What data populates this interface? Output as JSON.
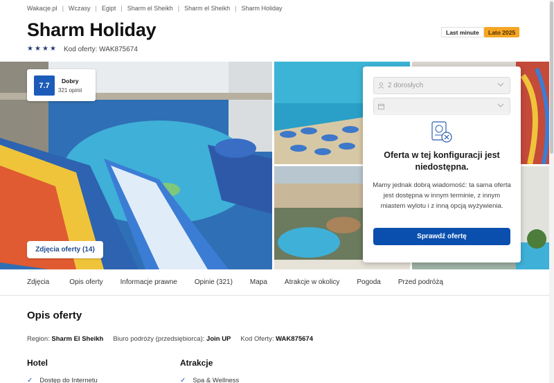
{
  "breadcrumb": [
    "Wakacje.pl",
    "Wczasy",
    "Egipt",
    "Sharm el Sheikh",
    "Sharm el Sheikh",
    "Sharm Holiday"
  ],
  "hotel": {
    "name": "Sharm Holiday",
    "stars": 4,
    "offer_code_label": "Kod oferty: WAK875674"
  },
  "badges": {
    "last_minute": "Last minute",
    "season": "Lato 2025"
  },
  "rating": {
    "score": "7.7",
    "word": "Dobry",
    "count": "321 opinii"
  },
  "photos_button": "Zdjęcia oferty (14)",
  "booking": {
    "guests_value": "2 dorosłych",
    "unavailable_title": "Oferta w tej konfiguracji jest niedostępna.",
    "unavailable_text": "Mamy jednak dobrą wiadomość: ta sama oferta jest dostępna w innym terminie, z innym miastem wylotu i z inną opcją wyżywienia.",
    "cta": "Sprawdź ofertę"
  },
  "tabs": [
    "Zdjęcia",
    "Opis oferty",
    "Informacje prawne",
    "Opinie (321)",
    "Mapa",
    "Atrakcje w okolicy",
    "Pogoda",
    "Przed podróżą"
  ],
  "description": {
    "title": "Opis oferty",
    "region_label": "Region:",
    "region_value": "Sharm El Sheikh",
    "agency_label": "Biuro podróży (przedsiębiorca):",
    "agency_value": "Join UP",
    "code_label": "Kod Oferty:",
    "code_value": "WAK875674"
  },
  "sections": {
    "hotel_title": "Hotel",
    "hotel_first": "Dostęp do Internetu",
    "attractions_title": "Atrakcje",
    "attractions_first": "Spa & Wellness"
  },
  "colors": {
    "brand_blue": "#0a4fae",
    "season_badge": "#f5a623",
    "rating_blue": "#1d5bb9"
  }
}
